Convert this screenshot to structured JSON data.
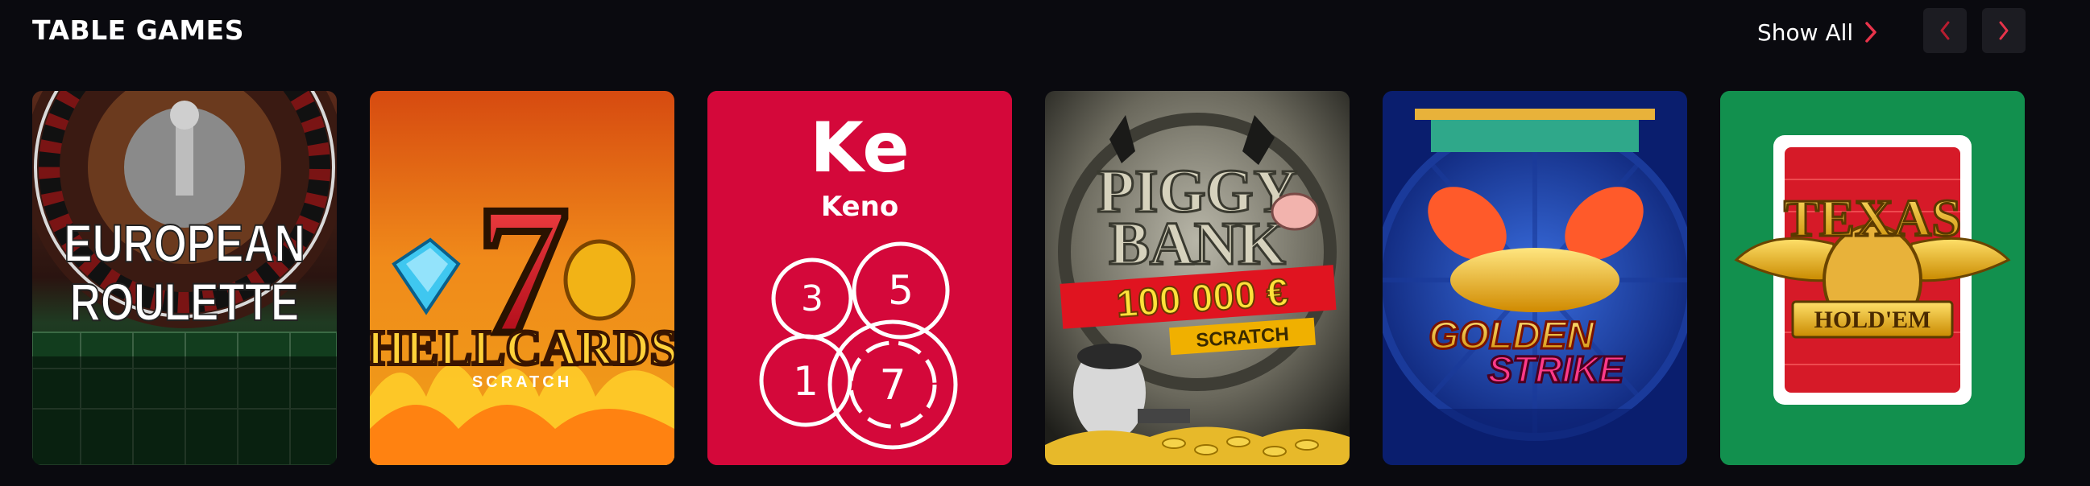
{
  "section": {
    "title": "TABLE GAMES",
    "show_all": "Show All"
  },
  "colors": {
    "background": "#0a0a0f",
    "accent": "#e8334a",
    "nav_button": "#1c1c22"
  },
  "games": [
    {
      "name": "European Roulette",
      "art_lines": [
        "EUROPEAN",
        "ROULETTE"
      ],
      "icon": "roulette-wheel"
    },
    {
      "name": "Hell Cards Scratch",
      "art_main": "HELLCARDS",
      "art_sub": "SCRATCH",
      "art_digit": "7",
      "icon": "seven-diamond-bell"
    },
    {
      "name": "Keno",
      "symbol": "Ke",
      "subtitle": "Keno",
      "balls": [
        "3",
        "5",
        "1",
        "7"
      ],
      "icon": "keno-balls"
    },
    {
      "name": "Piggy Bank Scratch",
      "art_lines": [
        "PIGGY",
        "BANK"
      ],
      "prize": "100 000 €",
      "art_sub": "SCRATCH",
      "icon": "piggy-bank"
    },
    {
      "name": "Golden Strike",
      "art_lines": [
        "GOLDEN",
        "STRIKE"
      ],
      "icon": "koi-fish"
    },
    {
      "name": "Texas Hold'em",
      "art_main": "TEXAS",
      "art_sub": "HOLD'EM",
      "icon": "bull-horns"
    }
  ]
}
